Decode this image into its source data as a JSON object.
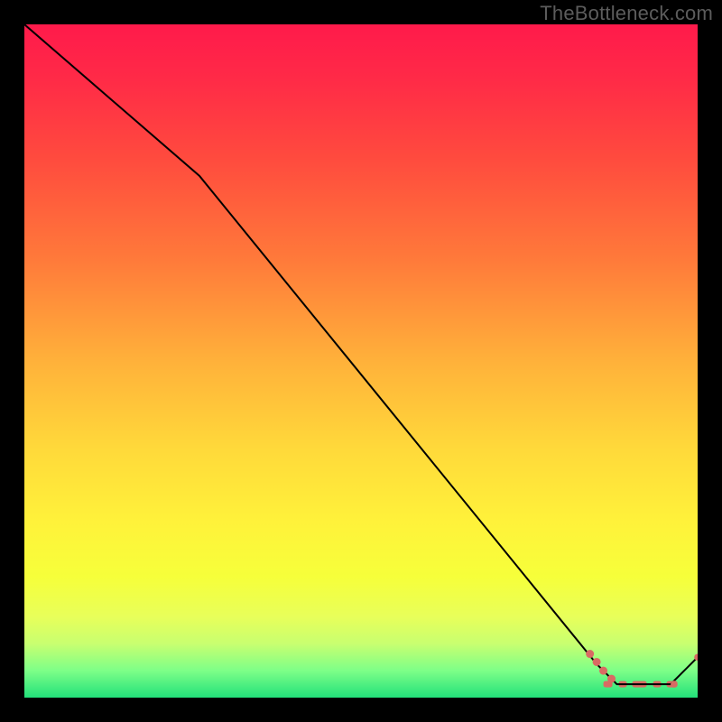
{
  "watermark": "TheBottleneck.com",
  "chart_data": {
    "type": "line",
    "title": "",
    "xlabel": "",
    "ylabel": "",
    "xlim": [
      0,
      100
    ],
    "ylim": [
      0,
      100
    ],
    "grid": false,
    "line_points": [
      {
        "x": 0.0,
        "y": 100.0
      },
      {
        "x": 26.0,
        "y": 77.5
      },
      {
        "x": 85.0,
        "y": 5.0
      },
      {
        "x": 88.0,
        "y": 2.0
      },
      {
        "x": 96.0,
        "y": 2.0
      },
      {
        "x": 100.0,
        "y": 6.0
      }
    ],
    "dash_segment": {
      "x_start": 86.0,
      "x_end": 97.0,
      "y": 2.0
    },
    "markers": [
      {
        "x": 84.0,
        "y": 6.5,
        "r": 4.5
      },
      {
        "x": 85.0,
        "y": 5.3,
        "r": 4.5
      },
      {
        "x": 86.0,
        "y": 4.0,
        "r": 4.5
      },
      {
        "x": 87.2,
        "y": 2.8,
        "r": 4.5
      },
      {
        "x": 96.5,
        "y": 2.0,
        "r": 3.8
      },
      {
        "x": 100.0,
        "y": 6.0,
        "r": 3.8
      }
    ],
    "gradient_stops": [
      {
        "offset": 0.0,
        "color": "#ff1a4b"
      },
      {
        "offset": 0.08,
        "color": "#ff2a47"
      },
      {
        "offset": 0.2,
        "color": "#ff4b3e"
      },
      {
        "offset": 0.35,
        "color": "#ff7a3a"
      },
      {
        "offset": 0.5,
        "color": "#ffb13a"
      },
      {
        "offset": 0.63,
        "color": "#ffd93a"
      },
      {
        "offset": 0.74,
        "color": "#fff23a"
      },
      {
        "offset": 0.82,
        "color": "#f6ff3a"
      },
      {
        "offset": 0.88,
        "color": "#e8ff5a"
      },
      {
        "offset": 0.92,
        "color": "#c8ff70"
      },
      {
        "offset": 0.96,
        "color": "#7dff88"
      },
      {
        "offset": 1.0,
        "color": "#22e07a"
      }
    ],
    "line_color": "#000000",
    "marker_color": "#d96a63"
  }
}
